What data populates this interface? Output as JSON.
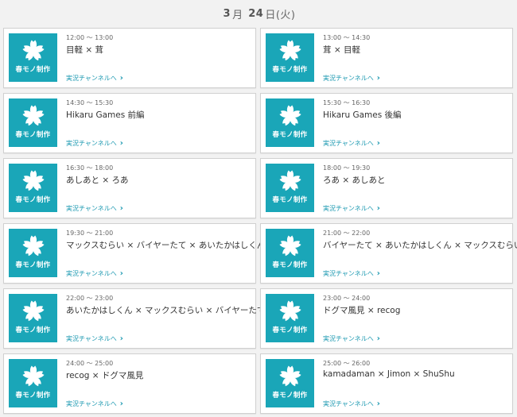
{
  "header": {
    "month": "3",
    "month_unit": "月",
    "day": "24",
    "day_unit": "日",
    "weekday": "(火)"
  },
  "brand": {
    "label": "春モノ制作",
    "color": "#1aa6b8"
  },
  "link_label": "実況チャンネルへ",
  "link_icon": "chevron-right-icon",
  "schedule": [
    {
      "time": "12:00 ～ 13:00",
      "title": "目軽 × 茸"
    },
    {
      "time": "13:00 ～ 14:30",
      "title": "茸 × 目軽"
    },
    {
      "time": "14:30 ～ 15:30",
      "title": "Hikaru Games 前編"
    },
    {
      "time": "15:30 ～ 16:30",
      "title": "Hikaru Games 後編"
    },
    {
      "time": "16:30 ～ 18:00",
      "title": "あしあと × ろあ"
    },
    {
      "time": "18:00 ～ 19:30",
      "title": "ろあ × あしあと"
    },
    {
      "time": "19:30 ～ 21:00",
      "title": "マックスむらい × バイヤーたて × あいたかはしくん"
    },
    {
      "time": "21:00 ～ 22:00",
      "title": "バイヤーたて × あいたかはしくん × マックスむらい"
    },
    {
      "time": "22:00 ～ 23:00",
      "title": "あいたかはしくん × マックスむらい × バイヤーたて"
    },
    {
      "time": "23:00 ～ 24:00",
      "title": "ドグマ風見 × recog"
    },
    {
      "time": "24:00 ～ 25:00",
      "title": "recog × ドグマ風見"
    },
    {
      "time": "25:00 ～ 26:00",
      "title": "kamadaman × Jimon × ShuShu"
    }
  ]
}
